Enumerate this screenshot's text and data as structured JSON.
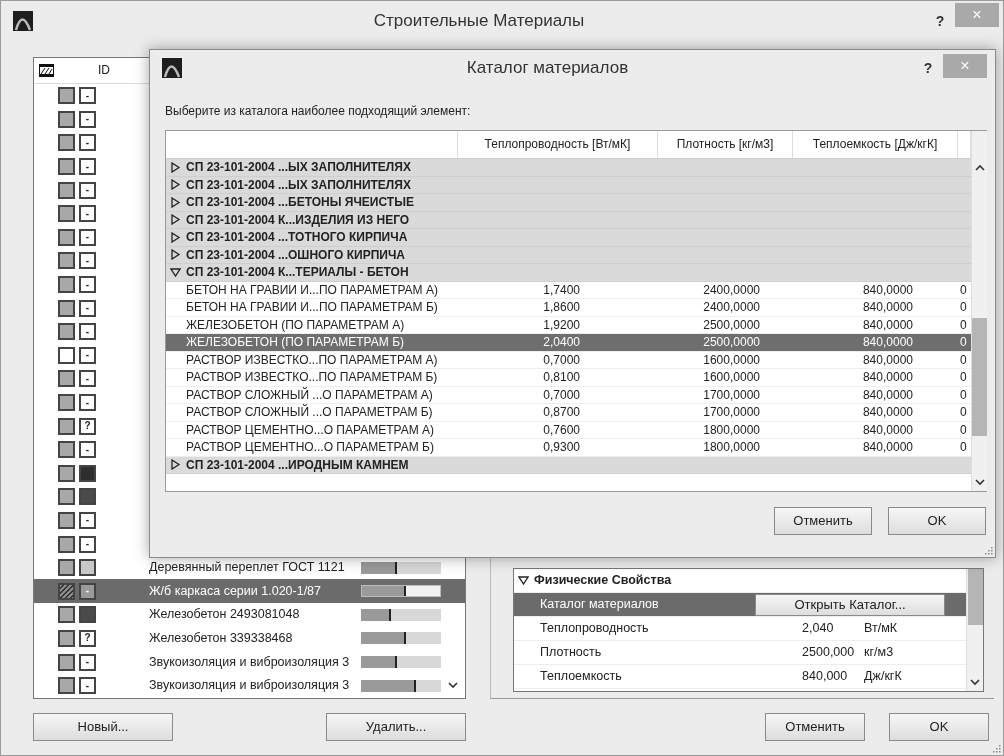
{
  "window": {
    "title": "Строительные Материалы",
    "help": "?",
    "close": "×"
  },
  "materials": {
    "header": {
      "id": "ID"
    },
    "rows": [
      {
        "color": "#a8a8a8",
        "hatched": false,
        "marker": {
          "kind": "text",
          "text": "-"
        },
        "selected": false
      },
      {
        "color": "#a8a8a8",
        "hatched": false,
        "marker": {
          "kind": "text",
          "text": "-"
        },
        "selected": false
      },
      {
        "color": "#a8a8a8",
        "hatched": false,
        "marker": {
          "kind": "text",
          "text": "-"
        },
        "selected": false
      },
      {
        "color": "#a8a8a8",
        "hatched": false,
        "marker": {
          "kind": "text",
          "text": "-"
        },
        "selected": false
      },
      {
        "color": "#a8a8a8",
        "hatched": false,
        "marker": {
          "kind": "text",
          "text": "-"
        },
        "selected": false
      },
      {
        "color": "#a8a8a8",
        "hatched": false,
        "marker": {
          "kind": "text",
          "text": "-"
        },
        "selected": false
      },
      {
        "color": "#a8a8a8",
        "hatched": false,
        "marker": {
          "kind": "text",
          "text": "-"
        },
        "selected": false
      },
      {
        "color": "#a8a8a8",
        "hatched": false,
        "marker": {
          "kind": "text",
          "text": "-"
        },
        "selected": false
      },
      {
        "color": "#a8a8a8",
        "hatched": false,
        "marker": {
          "kind": "text",
          "text": "-"
        },
        "selected": false
      },
      {
        "color": "#a8a8a8",
        "hatched": false,
        "marker": {
          "kind": "text",
          "text": "-"
        },
        "selected": false
      },
      {
        "color": "#a8a8a8",
        "hatched": false,
        "marker": {
          "kind": "text",
          "text": "-"
        },
        "selected": false
      },
      {
        "color": "#ffffff",
        "hatched": false,
        "marker": {
          "kind": "text",
          "text": "-"
        },
        "selected": false
      },
      {
        "color": "#a8a8a8",
        "hatched": false,
        "marker": {
          "kind": "text",
          "text": "-"
        },
        "selected": false
      },
      {
        "color": "#a8a8a8",
        "hatched": false,
        "marker": {
          "kind": "text",
          "text": "-"
        },
        "selected": false
      },
      {
        "color": "#a8a8a8",
        "hatched": false,
        "marker": {
          "kind": "text",
          "text": "?"
        },
        "selected": false
      },
      {
        "color": "#a8a8a8",
        "hatched": false,
        "marker": {
          "kind": "text",
          "text": "-"
        },
        "selected": false
      },
      {
        "color": "#a8a8a8",
        "hatched": false,
        "marker": {
          "kind": "swatch",
          "color": "#2e2e2e"
        },
        "selected": false
      },
      {
        "color": "#a8a8a8",
        "hatched": false,
        "marker": {
          "kind": "swatch",
          "color": "#4a4a4a"
        },
        "selected": false
      },
      {
        "color": "#a8a8a8",
        "hatched": false,
        "marker": {
          "kind": "text",
          "text": "-"
        },
        "selected": false
      },
      {
        "color": "#a8a8a8",
        "hatched": false,
        "marker": {
          "kind": "text",
          "text": "-"
        },
        "selected": false
      },
      {
        "color": "#a8a8a8",
        "hatched": false,
        "marker": {
          "kind": "swatch",
          "color": "#c8c8c8"
        },
        "name": "Деревянный переплет ГОСТ 1121",
        "level": 0.45,
        "selected": false
      },
      {
        "color": "#8a8a8a",
        "hatched": true,
        "marker": {
          "kind": "text",
          "text": "-"
        },
        "name": "Ж/б каркаса серии 1.020-1/87",
        "level": 0.56,
        "selected": true
      },
      {
        "color": "#a8a8a8",
        "hatched": false,
        "marker": {
          "kind": "swatch",
          "color": "#4a4a4a"
        },
        "name": "Железобетон 2493081048",
        "level": 0.38,
        "selected": false
      },
      {
        "color": "#a8a8a8",
        "hatched": false,
        "marker": {
          "kind": "text",
          "text": "?"
        },
        "name": "Железобетон 339338468",
        "level": 0.56,
        "selected": false
      },
      {
        "color": "#a8a8a8",
        "hatched": false,
        "marker": {
          "kind": "text",
          "text": "-"
        },
        "name": "Звукоизоляция и виброизоляция 3",
        "level": 0.45,
        "selected": false
      },
      {
        "color": "#a8a8a8",
        "hatched": false,
        "marker": {
          "kind": "text",
          "text": "-"
        },
        "name": "Звукоизоляция и виброизоляция 3",
        "level": 0.69,
        "selected": false
      }
    ],
    "buttons": [
      "Новый...",
      "Удалить..."
    ]
  },
  "properties": {
    "section": {
      "title": "Физические Свойства",
      "expanded": true
    },
    "rows": [
      {
        "kind": "button",
        "label": "Каталог материалов",
        "button": "Открыть Каталог...",
        "selected": true
      },
      {
        "kind": "value",
        "label": "Теплопроводность",
        "value": "2,040",
        "unit": "Вт/мК",
        "selected": false
      },
      {
        "kind": "value",
        "label": "Плотность",
        "value": "2500,000",
        "unit": "кг/м3",
        "selected": false
      },
      {
        "kind": "value",
        "label": "Теплоемкость",
        "value": "840,000",
        "unit": "Дж/кгК",
        "selected": false
      }
    ]
  },
  "footer_buttons": [
    "Отменить",
    "OK"
  ],
  "dialog": {
    "title": "Каталог материалов",
    "help": "?",
    "close": "×",
    "prompt": "Выберите из каталога наиболее подходящий элемент:",
    "table": {
      "columns": [
        "Теплопроводность [Вт/мК]",
        "Плотность [кг/м3]",
        "Теплоемкость [Дж/кгК]"
      ],
      "rows": [
        {
          "kind": "group",
          "name": "СП 23-101-2004 ...ЫХ ЗАПОЛНИТЕЛЯХ",
          "expanded": false,
          "selected": false
        },
        {
          "kind": "group",
          "name": "СП 23-101-2004 ...ЫХ ЗАПОЛНИТЕЛЯХ",
          "expanded": false,
          "selected": false
        },
        {
          "kind": "group",
          "name": "СП 23-101-2004 ...БЕТОНЫ ЯЧЕИСТЫЕ",
          "expanded": false,
          "selected": false
        },
        {
          "kind": "group",
          "name": "СП 23-101-2004 К...ИЗДЕЛИЯ ИЗ НЕГО",
          "expanded": false,
          "selected": false
        },
        {
          "kind": "group",
          "name": "СП 23-101-2004 ...ТОТНОГО КИРПИЧА",
          "expanded": false,
          "selected": false
        },
        {
          "kind": "group",
          "name": "СП 23-101-2004 ...ОШНОГО КИРПИЧА",
          "expanded": false,
          "selected": false
        },
        {
          "kind": "group",
          "name": "СП 23-101-2004 К...ТЕРИАЛЫ - БЕТОН",
          "expanded": true,
          "selected": false
        },
        {
          "kind": "item",
          "name": "БЕТОН НА ГРАВИИ И...ПО ПАРАМЕТРАМ А)",
          "values": [
            "1,7400",
            "2400,0000",
            "840,0000",
            "0"
          ],
          "selected": false
        },
        {
          "kind": "item",
          "name": "БЕТОН НА ГРАВИИ И...ПО ПАРАМЕТРАМ Б)",
          "values": [
            "1,8600",
            "2400,0000",
            "840,0000",
            "0"
          ],
          "selected": false
        },
        {
          "kind": "item",
          "name": "ЖЕЛЕЗОБЕТОН (ПО ПАРАМЕТРАМ А)",
          "values": [
            "1,9200",
            "2500,0000",
            "840,0000",
            "0"
          ],
          "selected": false
        },
        {
          "kind": "item",
          "name": "ЖЕЛЕЗОБЕТОН (ПО ПАРАМЕТРАМ Б)",
          "values": [
            "2,0400",
            "2500,0000",
            "840,0000",
            "0"
          ],
          "selected": true
        },
        {
          "kind": "item",
          "name": "РАСТВОР ИЗВЕСТКО...ПО ПАРАМЕТРАМ А)",
          "values": [
            "0,7000",
            "1600,0000",
            "840,0000",
            "0"
          ],
          "selected": false
        },
        {
          "kind": "item",
          "name": "РАСТВОР ИЗВЕСТКО...ПО ПАРАМЕТРАМ Б)",
          "values": [
            "0,8100",
            "1600,0000",
            "840,0000",
            "0"
          ],
          "selected": false
        },
        {
          "kind": "item",
          "name": "РАСТВОР СЛОЖНЫЙ ...О ПАРАМЕТРАМ А)",
          "values": [
            "0,7000",
            "1700,0000",
            "840,0000",
            "0"
          ],
          "selected": false
        },
        {
          "kind": "item",
          "name": "РАСТВОР СЛОЖНЫЙ ...О ПАРАМЕТРАМ Б)",
          "values": [
            "0,8700",
            "1700,0000",
            "840,0000",
            "0"
          ],
          "selected": false
        },
        {
          "kind": "item",
          "name": "РАСТВОР ЦЕМЕНТНО...О ПАРАМЕТРАМ А)",
          "values": [
            "0,7600",
            "1800,0000",
            "840,0000",
            "0"
          ],
          "selected": false
        },
        {
          "kind": "item",
          "name": "РАСТВОР ЦЕМЕНТНО...О ПАРАМЕТРАМ Б)",
          "values": [
            "0,9300",
            "1800,0000",
            "840,0000",
            "0"
          ],
          "selected": false
        },
        {
          "kind": "group",
          "name": "СП 23-101-2004 ...ИРОДНЫМ КАМНЕМ",
          "expanded": false,
          "selected": false
        }
      ]
    },
    "buttons": [
      "Отменить",
      "OK"
    ]
  }
}
